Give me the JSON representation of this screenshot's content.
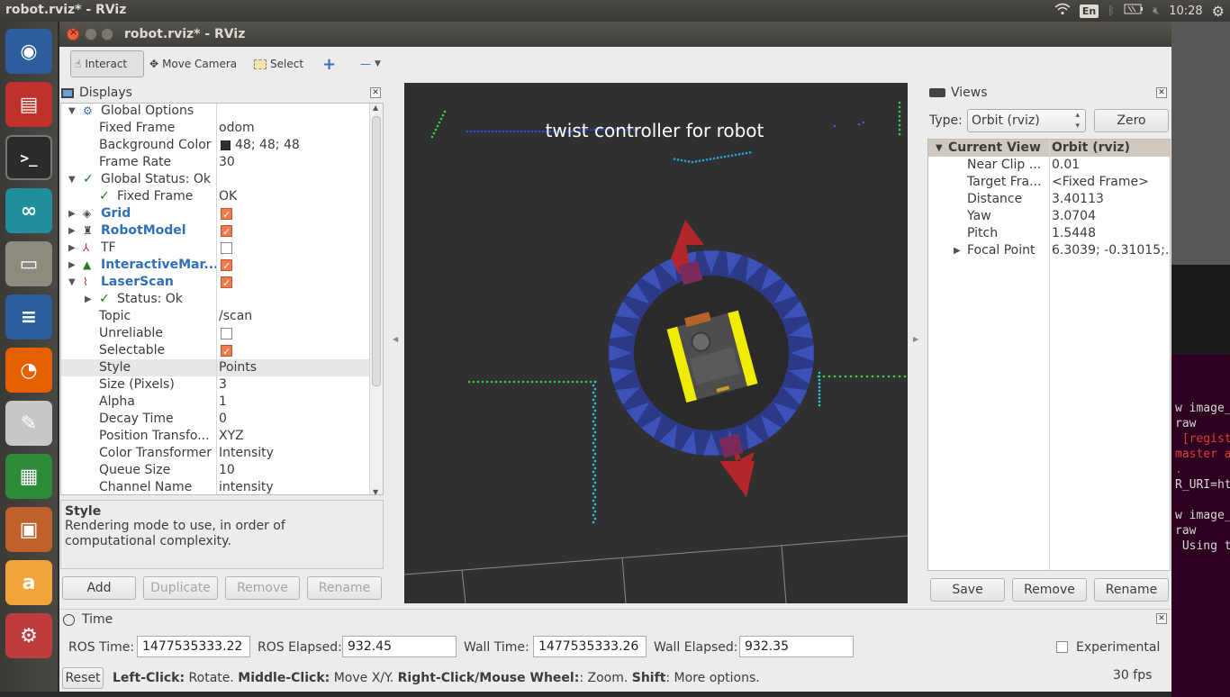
{
  "system": {
    "window_title": "robot.rviz* - RViz",
    "lang": "En",
    "clock": "10:28"
  },
  "launcher": [
    {
      "icon": "ubuntu-dash-icon",
      "color": "#2c5e9e"
    },
    {
      "icon": "rviz-app-icon",
      "color": "#c0312b"
    },
    {
      "icon": "terminal-icon",
      "color": "#2b2b2b"
    },
    {
      "icon": "arduino-icon",
      "color": "#1f8f9c"
    },
    {
      "icon": "files-icon",
      "color": "#8e8a80"
    },
    {
      "icon": "writer-icon",
      "color": "#2a5f9e"
    },
    {
      "icon": "firefox-icon",
      "color": "#e66000"
    },
    {
      "icon": "text-editor-icon",
      "color": "#c7c7c7"
    },
    {
      "icon": "calc-icon",
      "color": "#2e8b3a"
    },
    {
      "icon": "impress-icon",
      "color": "#c0612b"
    },
    {
      "icon": "amazon-icon",
      "color": "#f2a33a"
    },
    {
      "icon": "settings-icon",
      "color": "#c03b3b"
    }
  ],
  "window": {
    "title": "robot.rviz* - RViz"
  },
  "toolbar": {
    "interact": "Interact",
    "move_camera": "Move Camera",
    "select": "Select",
    "plus": "+",
    "minus": "—"
  },
  "displays": {
    "title": "Displays",
    "rows": [
      {
        "name": "Global Options",
        "value": "",
        "indent": 0,
        "arrow": "▼",
        "icon": "gear-icon"
      },
      {
        "name": "Fixed Frame",
        "value": "odom",
        "indent": 1
      },
      {
        "name": "Background Color",
        "value": "48; 48; 48",
        "indent": 1,
        "swatch": "#303030"
      },
      {
        "name": "Frame Rate",
        "value": "30",
        "indent": 1
      },
      {
        "name": "Global Status: Ok",
        "value": "",
        "indent": 0,
        "arrow": "▼",
        "tick": true
      },
      {
        "name": "Fixed Frame",
        "value": "OK",
        "indent": 1,
        "tick": true
      },
      {
        "name": "Grid",
        "value": "",
        "indent": 0,
        "arrow": "▶",
        "blue": true,
        "check": true,
        "icon": "grid-icon"
      },
      {
        "name": "RobotModel",
        "value": "",
        "indent": 0,
        "arrow": "▶",
        "blue": true,
        "check": true,
        "icon": "robot-icon"
      },
      {
        "name": "TF",
        "value": "",
        "indent": 0,
        "arrow": "▶",
        "check": false,
        "icon": "tf-icon"
      },
      {
        "name": "InteractiveMar...",
        "value": "",
        "indent": 0,
        "arrow": "▶",
        "blue": true,
        "check": true,
        "icon": "interactive-marker-icon"
      },
      {
        "name": "LaserScan",
        "value": "",
        "indent": 0,
        "arrow": "▼",
        "blue": true,
        "check": true,
        "icon": "laserscan-icon"
      },
      {
        "name": "Status: Ok",
        "value": "",
        "indent": 1,
        "arrow": "▶",
        "tick": true
      },
      {
        "name": "Topic",
        "value": "/scan",
        "indent": 1
      },
      {
        "name": "Unreliable",
        "value": "",
        "indent": 1,
        "check": false,
        "valcheck": true
      },
      {
        "name": "Selectable",
        "value": "",
        "indent": 1,
        "check": true,
        "valcheck": true
      },
      {
        "name": "Style",
        "value": "Points",
        "indent": 1,
        "selected": true
      },
      {
        "name": "Size (Pixels)",
        "value": "3",
        "indent": 1
      },
      {
        "name": "Alpha",
        "value": "1",
        "indent": 1
      },
      {
        "name": "Decay Time",
        "value": "0",
        "indent": 1
      },
      {
        "name": "Position Transfo...",
        "value": "XYZ",
        "indent": 1
      },
      {
        "name": "Color Transformer",
        "value": "Intensity",
        "indent": 1
      },
      {
        "name": "Queue Size",
        "value": "10",
        "indent": 1
      },
      {
        "name": "Channel Name",
        "value": "intensity",
        "indent": 1
      }
    ],
    "help_title": "Style",
    "help_text": "Rendering mode to use, in order of computational complexity.",
    "buttons": {
      "add": "Add",
      "duplicate": "Duplicate",
      "remove": "Remove",
      "rename": "Rename"
    }
  },
  "viewport": {
    "overlay_text": "twist  controller  for  robot"
  },
  "views": {
    "title": "Views",
    "type_label": "Type:",
    "type_value": "Orbit (rviz)",
    "zero": "Zero",
    "header_name": "Current View",
    "header_value": "Orbit (rviz)",
    "rows": [
      {
        "name": "Near Clip ...",
        "value": "0.01"
      },
      {
        "name": "Target Fra...",
        "value": "<Fixed Frame>"
      },
      {
        "name": "Distance",
        "value": "3.40113"
      },
      {
        "name": "Yaw",
        "value": "3.0704"
      },
      {
        "name": "Pitch",
        "value": "1.5448"
      },
      {
        "name": "Focal Point",
        "value": "6.3039; -0.31015;...",
        "arrow": "▶"
      }
    ],
    "buttons": {
      "save": "Save",
      "remove": "Remove",
      "rename": "Rename"
    }
  },
  "time": {
    "title": "Time",
    "ros_time_label": "ROS Time:",
    "ros_time": "1477535333.22",
    "ros_elapsed_label": "ROS Elapsed:",
    "ros_elapsed": "932.45",
    "wall_time_label": "Wall Time:",
    "wall_time": "1477535333.26",
    "wall_elapsed_label": "Wall Elapsed:",
    "wall_elapsed": "932.35",
    "experimental": "Experimental"
  },
  "status": {
    "reset": "Reset",
    "k1": "Left-Click:",
    "t1": " Rotate. ",
    "k2": "Middle-Click:",
    "t2": " Move X/Y. ",
    "k3": "Right-Click/Mouse Wheel:",
    "t3": ": Zoom. ",
    "k4": "Shift",
    "t4": ": More options.",
    "fps": "30 fps"
  },
  "terminal": {
    "lines": [
      {
        "text": "w image_",
        "color": "#d8d8d8"
      },
      {
        "text": "raw",
        "color": "#d8d8d8"
      },
      {
        "text": " [regist",
        "color": "#e03c3c"
      },
      {
        "text": "master a",
        "color": "#e03c3c"
      },
      {
        "text": ".",
        "color": "#e03c3c"
      },
      {
        "text": "R_URI=ht",
        "color": "#d8d8d8"
      },
      {
        "text": "",
        "color": "#d8d8d8"
      },
      {
        "text": "w image_",
        "color": "#d8d8d8"
      },
      {
        "text": "raw",
        "color": "#d8d8d8"
      },
      {
        "text": " Using t",
        "color": "#d8d8d8"
      }
    ]
  }
}
